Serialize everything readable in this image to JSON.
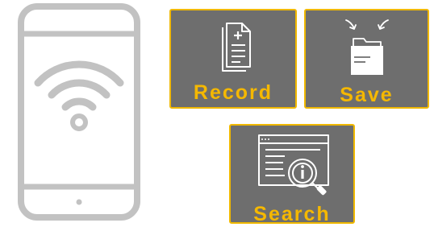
{
  "colors": {
    "tile_background": "#6e6e6e",
    "tile_border": "#f0b800",
    "label_text": "#f5b800",
    "phone_outline": "#c2c2c2",
    "icon_stroke": "#ffffff"
  },
  "phone": {
    "icons": [
      "phone-outline-icon",
      "wifi-icon",
      "home-button-icon"
    ]
  },
  "tiles": {
    "record": {
      "label": "Record",
      "icon": "document-add-icon"
    },
    "save": {
      "label": "Save",
      "icon": "folder-save-icon"
    },
    "search": {
      "label": "Search",
      "icon": "web-search-icon"
    }
  }
}
